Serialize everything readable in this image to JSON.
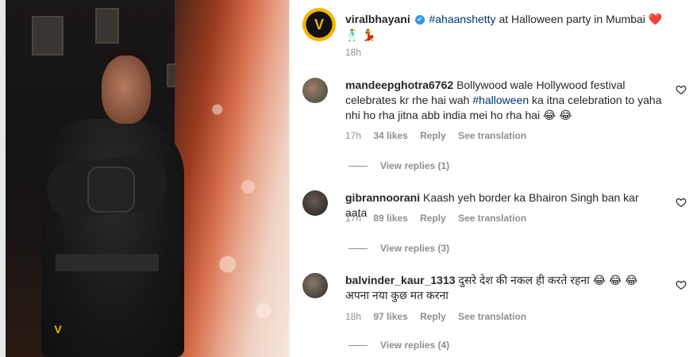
{
  "post": {
    "username": "viralbhayani",
    "verified_mark": "✔",
    "hashtag": "#ahaanshetty",
    "caption_text": " at Halloween party in Mumbai ",
    "caption_emojis": "❤️",
    "caption_emojis_line2": "🕺 💃",
    "time": "18h",
    "watermark_logo": "V"
  },
  "comments": [
    {
      "username": "mandeepghotra6762",
      "text_before": "Bollywood wale Hollywood festival celebrates kr rhe hai wah ",
      "hashtag": "#halloween",
      "text_after": " ka itna celebration to yaha nhi ho rha jitna abb india mei ho rha hai 😂 😂",
      "time": "17h",
      "likes": "34 likes",
      "reply": "Reply",
      "see_translation": "See translation",
      "view_replies": "View replies (1)"
    },
    {
      "username": "gibrannoorani",
      "text": "Kaash yeh border ka Bhairon Singh ban kar aata",
      "time": "17h",
      "likes": "89 likes",
      "reply": "Reply",
      "see_translation": "See translation",
      "view_replies": "View replies (3)"
    },
    {
      "username": "balvinder_kaur_1313",
      "text": "दुसरे देश की नकल ही करते रहना 😂 😂 😂 अपना नया कुछ मत करना",
      "time": "18h",
      "likes": "97 likes",
      "reply": "Reply",
      "see_translation": "See translation",
      "view_replies": "View replies (4)"
    }
  ],
  "colors": {
    "link": "#00376b",
    "meta": "#8e8e8e",
    "heart": "#ed4956",
    "brand_yellow": "#f4b400"
  }
}
